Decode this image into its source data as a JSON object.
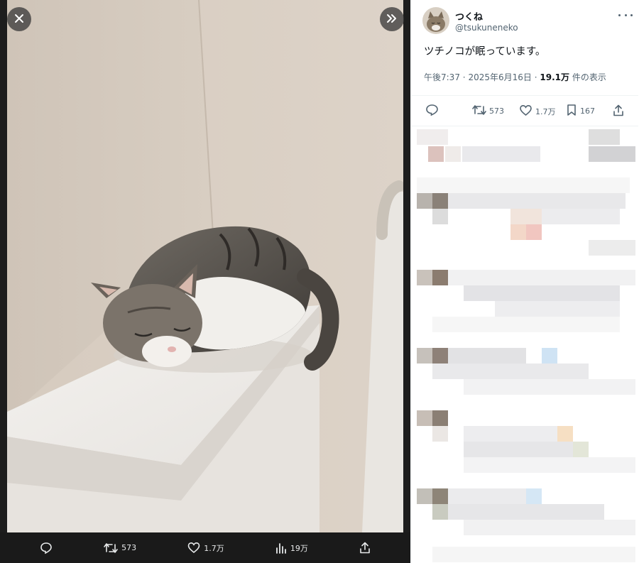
{
  "user": {
    "display_name": "つくね",
    "handle": "@tsukuneneko"
  },
  "tweet": {
    "text": "ツチノコが眠っています。",
    "time": "午後7:37",
    "separator": "·",
    "date": "2025年6月16日",
    "views_count": "19.1万",
    "views_label": "件の表示"
  },
  "panel_stats": {
    "retweets": "573",
    "likes": "1.7万",
    "bookmarks": "167"
  },
  "viewer_bar": {
    "retweets": "573",
    "likes": "1.7万",
    "views": "19万"
  },
  "icons": {
    "close": "close-icon",
    "expand": "chevrons-right-icon",
    "reply": "reply-icon",
    "retweet": "retweet-icon",
    "like": "heart-icon",
    "views": "views-icon",
    "bookmark": "bookmark-icon",
    "share": "share-icon",
    "more": "more-icon"
  },
  "colors": {
    "viewer_background": "#1d1d1d",
    "panel_background": "#ffffff",
    "secondary_text": "#536471",
    "primary_text": "#0f1419"
  }
}
